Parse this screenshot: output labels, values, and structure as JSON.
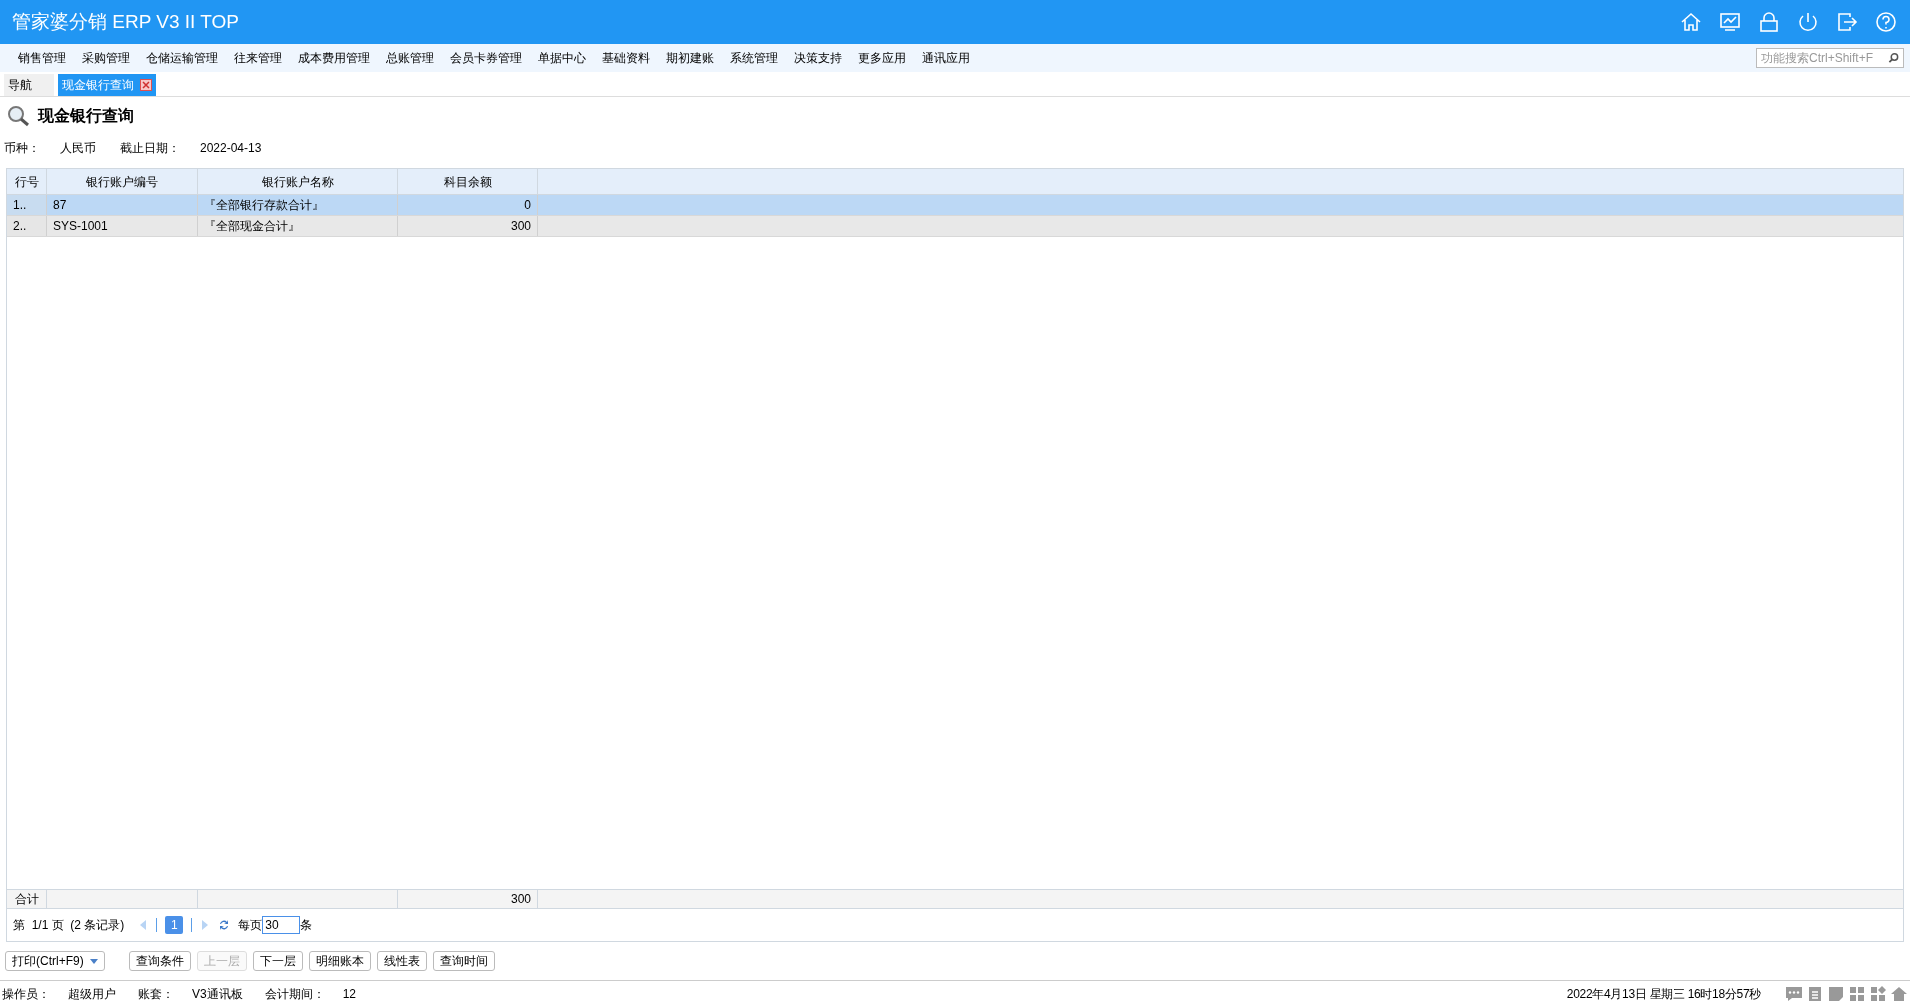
{
  "app_title": "管家婆分销 ERP V3 II TOP",
  "menu": [
    "销售管理",
    "采购管理",
    "仓储运输管理",
    "往来管理",
    "成本费用管理",
    "总账管理",
    "会员卡券管理",
    "单据中心",
    "基础资料",
    "期初建账",
    "系统管理",
    "决策支持",
    "更多应用",
    "通讯应用"
  ],
  "search": {
    "placeholder": "功能搜索Ctrl+Shift+F"
  },
  "tabs": [
    {
      "label": "导航",
      "selected": false,
      "closable": false
    },
    {
      "label": "现金银行查询",
      "selected": true,
      "closable": true
    }
  ],
  "page_title": "现金银行查询",
  "filters": [
    {
      "label": "币种：",
      "value": "人民币"
    },
    {
      "label": "截止日期：",
      "value": "2022-04-13"
    }
  ],
  "table": {
    "columns": [
      "行号",
      "银行账户编号",
      "银行账户名称",
      "科目余额"
    ],
    "rows": [
      {
        "cells": [
          "1..",
          "87",
          "『全部银行存款合计』",
          "0"
        ],
        "selected": true
      },
      {
        "cells": [
          "2..",
          "SYS-1001",
          "『全部现金合计』",
          "300"
        ],
        "selected": false
      }
    ],
    "total": {
      "label": "合计",
      "amount": "300"
    }
  },
  "pager": {
    "info": "第  1/1 页  (2 条记录)",
    "pages": [
      {
        "label": "1",
        "selected": true
      }
    ],
    "per_page_label": "每页",
    "per_page": "30",
    "unit": "条"
  },
  "buttons": [
    {
      "label": "打印(Ctrl+F9)",
      "kind": "dropdown",
      "disabled": false
    },
    {
      "label": "查询条件",
      "kind": "plain",
      "disabled": false
    },
    {
      "label": "上一层",
      "kind": "plain",
      "disabled": true
    },
    {
      "label": "下一层",
      "kind": "plain",
      "disabled": false
    },
    {
      "label": "明细账本",
      "kind": "plain",
      "disabled": false
    },
    {
      "label": "线性表",
      "kind": "plain",
      "disabled": false
    },
    {
      "label": "查询时间",
      "kind": "plain",
      "disabled": false
    }
  ],
  "status_bar": {
    "fields": [
      {
        "label": "操作员：",
        "value": "超级用户"
      },
      {
        "label": "账套：",
        "value": "V3通讯板"
      },
      {
        "label": "会计期间：",
        "value": "12"
      }
    ],
    "datetime": "2022年4月13日  星期三  16时18分57秒"
  }
}
